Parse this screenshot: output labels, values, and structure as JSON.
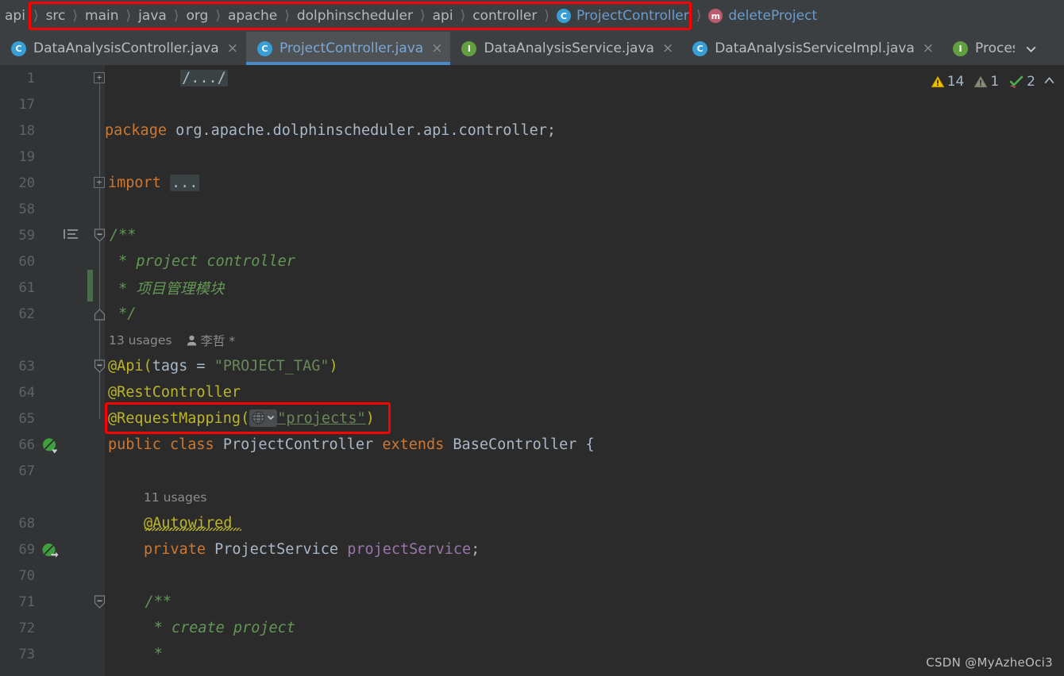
{
  "breadcrumb": {
    "root_label": "api",
    "crumbs": [
      {
        "label": "src",
        "icon": ""
      },
      {
        "label": "main",
        "icon": ""
      },
      {
        "label": "java",
        "icon": ""
      },
      {
        "label": "org",
        "icon": ""
      },
      {
        "label": "apache",
        "icon": ""
      },
      {
        "label": "dolphinscheduler",
        "icon": ""
      },
      {
        "label": "api",
        "icon": ""
      },
      {
        "label": "controller",
        "icon": ""
      },
      {
        "label": "ProjectController",
        "icon": "class-icon",
        "icon_letter": "C"
      },
      {
        "label": "deleteProject",
        "icon": "method-icon",
        "icon_letter": "m"
      }
    ],
    "separator": "〉",
    "highlight_color": "#ff0000"
  },
  "tabs": [
    {
      "label": "DataAnalysisController.java",
      "icon_letter": "C",
      "icon_kind": "class-icon",
      "active": false,
      "close": "×"
    },
    {
      "label": "ProjectController.java",
      "icon_letter": "C",
      "icon_kind": "class-icon",
      "active": true,
      "close": "×"
    },
    {
      "label": "DataAnalysisService.java",
      "icon_letter": "I",
      "icon_kind": "interface-icon",
      "active": false,
      "close": "×"
    },
    {
      "label": "DataAnalysisServiceImpl.java",
      "icon_letter": "C",
      "icon_kind": "class-icon",
      "active": false,
      "close": "×"
    },
    {
      "label": "Process",
      "icon_letter": "I",
      "icon_kind": "interface-icon",
      "active": false,
      "close": ""
    }
  ],
  "tab_overflow_icon": "chevron-down-icon",
  "inspections": {
    "warnings": "14",
    "weak_warnings": "1",
    "ok_count": "2",
    "collapse_icon": "chevron-up-icon"
  },
  "editor": {
    "line_numbers": [
      "1",
      "17",
      "18",
      "19",
      "20",
      "58",
      "59",
      "60",
      "61",
      "62",
      "",
      "63",
      "64",
      "65",
      "66",
      "67",
      "",
      "68",
      "69",
      "70",
      "71",
      "72",
      "73"
    ],
    "code_lines": [
      {
        "num": "1",
        "kind": "fold-license",
        "text": "/.../"
      },
      {
        "num": "17",
        "kind": "blank",
        "text": ""
      },
      {
        "num": "18",
        "kind": "package",
        "keyword": "package",
        "value": " org.apache.dolphinscheduler.api.controller;"
      },
      {
        "num": "19",
        "kind": "blank",
        "text": ""
      },
      {
        "num": "20",
        "kind": "fold-import",
        "keyword": "import",
        "placeholder": "..."
      },
      {
        "num": "58",
        "kind": "blank",
        "text": ""
      },
      {
        "num": "59",
        "kind": "comment",
        "text": "/**"
      },
      {
        "num": "60",
        "kind": "comment",
        "text": " * project controller"
      },
      {
        "num": "61",
        "kind": "comment",
        "text": " * 项目管理模块"
      },
      {
        "num": "62",
        "kind": "comment",
        "text": " */"
      },
      {
        "num": "",
        "kind": "inlay-usages",
        "usages": "13 usages",
        "author": "李哲 *",
        "author_icon": "person-icon"
      },
      {
        "num": "63",
        "kind": "anno-api",
        "anno": "@Api(",
        "param": "tags",
        "eq": " = ",
        "str": "\"PROJECT_TAG\"",
        "close": ")"
      },
      {
        "num": "64",
        "kind": "anno",
        "text": "@RestController"
      },
      {
        "num": "65",
        "kind": "anno-mapping",
        "anno": "@RequestMapping(",
        "badge": "globe-icon",
        "str": "\"projects\"",
        "close": ")"
      },
      {
        "num": "66",
        "kind": "class-decl",
        "kw1": "public",
        "kw2": "class",
        "name": "ProjectController",
        "kw3": "extends",
        "parent": "BaseController",
        "brace": "{"
      },
      {
        "num": "67",
        "kind": "blank",
        "text": ""
      },
      {
        "num": "",
        "kind": "inlay-usages",
        "usages": "11 usages",
        "author": "",
        "author_icon": ""
      },
      {
        "num": "68",
        "kind": "anno-warn",
        "text": "@Autowired"
      },
      {
        "num": "69",
        "kind": "field-decl",
        "kw": "private",
        "type": "ProjectService",
        "name": "projectService",
        "semi": ";"
      },
      {
        "num": "70",
        "kind": "blank",
        "text": ""
      },
      {
        "num": "71",
        "kind": "comment",
        "text": "    /**"
      },
      {
        "num": "72",
        "kind": "comment",
        "text": "     * create project"
      },
      {
        "num": "73",
        "kind": "comment",
        "text": "     *"
      }
    ],
    "gutter_icons": [
      {
        "line": "59",
        "name": "doc-comment-icon"
      },
      {
        "line": "66",
        "name": "spring-bean-icon"
      },
      {
        "line": "69",
        "name": "spring-autowired-icon"
      }
    ],
    "code_highlight_color": "#ff0000"
  },
  "watermark": "CSDN @MyAzheOci3",
  "colors": {
    "background": "#2b2b2b",
    "gutter": "#313335",
    "chrome": "#3c3f41",
    "accent_blue": "#4a88c7",
    "keyword_orange": "#cc7832",
    "string_green": "#6a8759",
    "comment_green": "#629755",
    "annotation_yellow": "#bbb529",
    "field_purple": "#9876aa",
    "identifier": "#a9b7c6",
    "highlight_red": "#ff0000"
  }
}
